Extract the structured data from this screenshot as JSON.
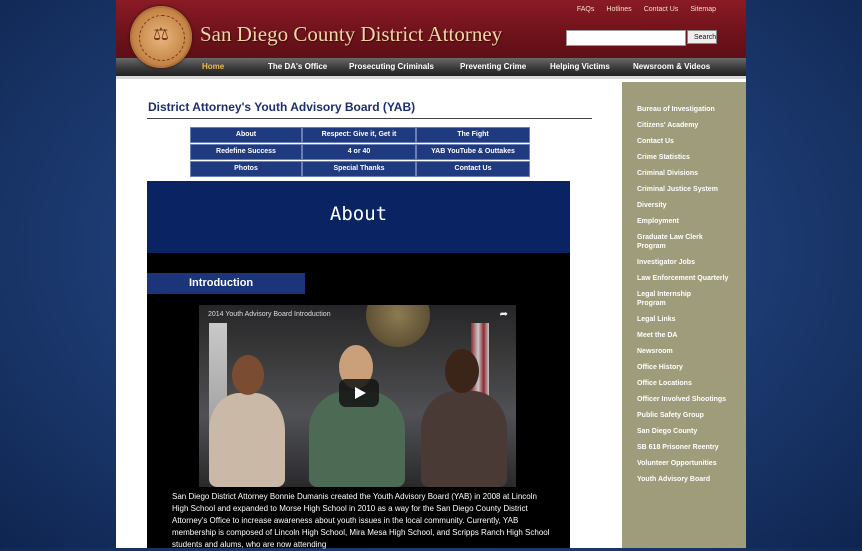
{
  "header": {
    "site_title": "San Diego County District Attorney",
    "top_links": [
      "FAQs",
      "Hotlines",
      "Contact Us",
      "Sitemap"
    ],
    "search_placeholder": "",
    "search_button": "Search"
  },
  "nav": {
    "items": [
      "Home",
      "The DA's Office",
      "Prosecuting Criminals",
      "Preventing Crime",
      "Helping Victims",
      "Newsroom & Videos"
    ],
    "active": "Home"
  },
  "content": {
    "page_title": "District Attorney's Youth Advisory Board (YAB)",
    "subnav": [
      "About",
      "Respect: Give it, Get it",
      "The Fight",
      "Redefine Success",
      "4 or 40",
      "YAB YouTube & Outtakes",
      "Photos",
      "Special Thanks",
      "Contact Us"
    ],
    "about_heading": "About",
    "intro_heading": "Introduction",
    "video_title": "2014 Youth Advisory Board Introduction",
    "intro_paragraph": "San Diego District Attorney Bonnie Dumanis created the Youth Advisory Board (YAB) in 2008 at Lincoln High School and expanded to Morse High School in 2010 as a way for the San Diego County District Attorney's Office to increase awareness about youth issues in the local community. Currently, YAB membership is composed of Lincoln High School, Mira Mesa High School, and Scripps Ranch High School students and alums, who are now attending"
  },
  "sidebar": {
    "items": [
      "Bureau of Investigation",
      "Citizens' Academy",
      "Contact Us",
      "Crime Statistics",
      "Criminal Divisions",
      "Criminal Justice System",
      "Diversity",
      "Employment",
      "Graduate Law Clerk Program",
      "Investigator Jobs",
      "Law Enforcement Quarterly",
      "Legal Internship Program",
      "Legal Links",
      "Meet the DA",
      "Newsroom",
      "Office History",
      "Office Locations",
      "Officer Involved Shootings",
      "Public Safety Group",
      "San Diego County",
      "SB 618 Prisoner Reentry",
      "Volunteer Opportunities",
      "Youth Advisory Board"
    ]
  },
  "icons": {
    "seal": "county-seal-icon",
    "share": "share-icon",
    "play": "play-icon"
  },
  "colors": {
    "header": "#7a1620",
    "nav": "#3a3a3a",
    "subnav": "#203a80",
    "sidebar": "#9e9c7a",
    "title": "#1d2f6e"
  }
}
